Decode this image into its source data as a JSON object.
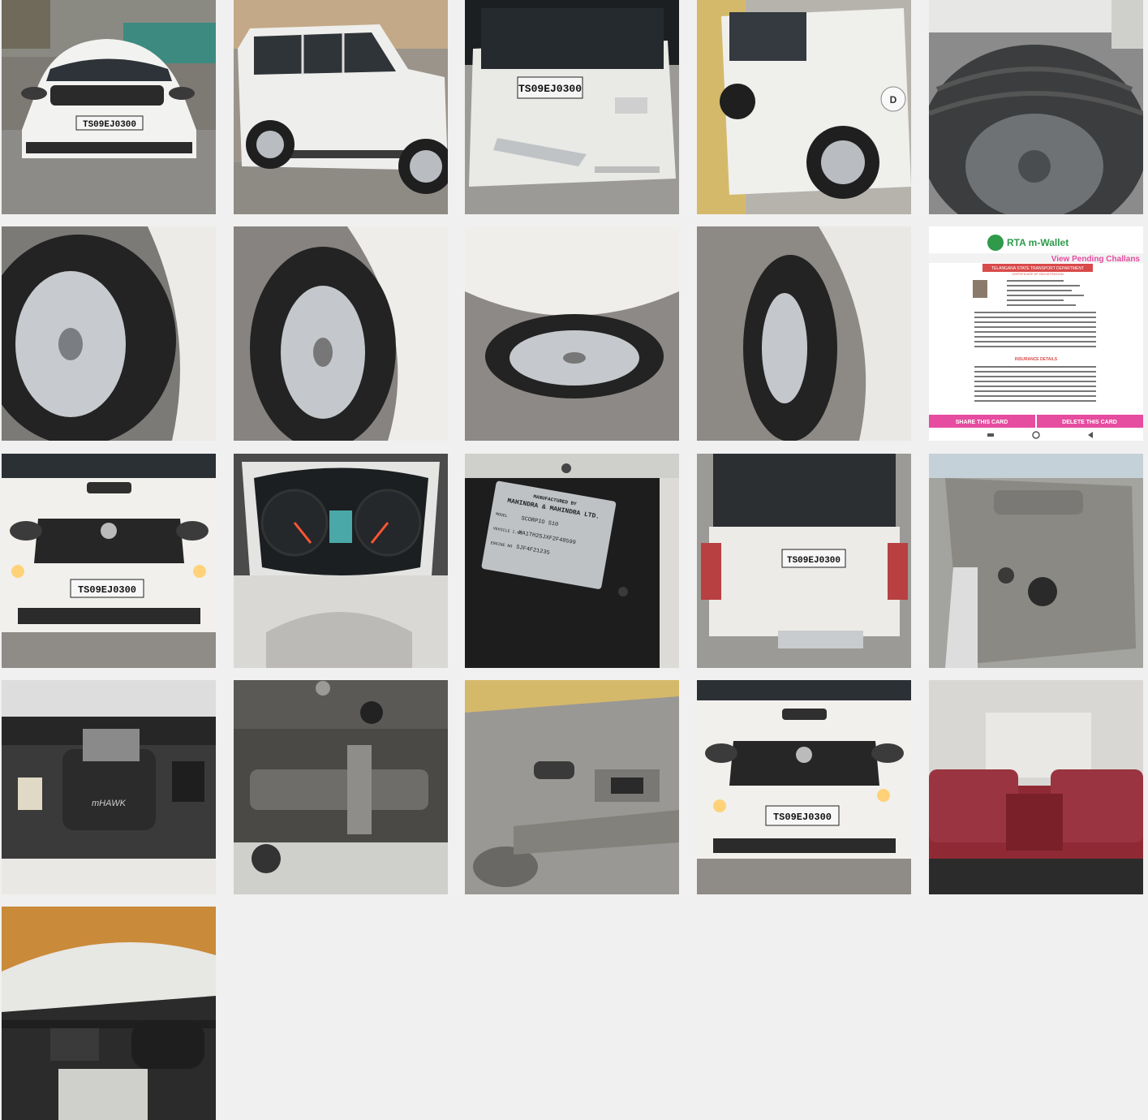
{
  "gallery": {
    "plate_number": "TS09EJ0300",
    "tiles": [
      {
        "label": "front-view"
      },
      {
        "label": "side-view"
      },
      {
        "label": "rear-view"
      },
      {
        "label": "side-door-view"
      },
      {
        "label": "spare-tyre"
      },
      {
        "label": "tyre-front-left"
      },
      {
        "label": "tyre-rear-left"
      },
      {
        "label": "tyre-alloy-wheel"
      },
      {
        "label": "tyre-front-right"
      },
      {
        "label": "rta-mwallet-card"
      },
      {
        "label": "front-view-closeup"
      },
      {
        "label": "instrument-cluster"
      },
      {
        "label": "vin-plate"
      },
      {
        "label": "rear-open-view"
      },
      {
        "label": "tailgate-interior"
      },
      {
        "label": "engine-bay"
      },
      {
        "label": "underbody"
      },
      {
        "label": "door-trim"
      },
      {
        "label": "front-view-2"
      },
      {
        "label": "rear-seats"
      },
      {
        "label": "dashboard"
      }
    ]
  },
  "rta_card": {
    "app_title": "RTA m-Wallet",
    "link": "View Pending Challans",
    "department": "TELANGANA STATE TRANSPORT DEPARTMENT",
    "certificate": "CERTIFICATE OF REGISTRATION",
    "insurance_header": "INSURANCE DETAILS",
    "share_button": "SHARE THIS CARD",
    "delete_button": "DELETE THIS CARD"
  },
  "vin_plate": {
    "line1": "MANUFACTURED BY",
    "line2": "MAHINDRA & MAHINDRA LTD.",
    "model_label": "MODEL",
    "vin_label": "VEHICLE I.NO",
    "engine_label": "ENGINE NO",
    "model_value": "SCORPIO S10",
    "vin_value": "MA1TH2SJXF2F48599",
    "engine_value": "SJF4F21235"
  },
  "badges": {
    "engine_cover": "mHAWK"
  },
  "colors": {
    "background": "#f0f0f0",
    "car_white": "#f2f2f0",
    "grille": "#2a2a2a",
    "rta_pink": "#e64ca0",
    "rta_green": "#2e9a4a",
    "seat_red": "#8f2a34"
  }
}
